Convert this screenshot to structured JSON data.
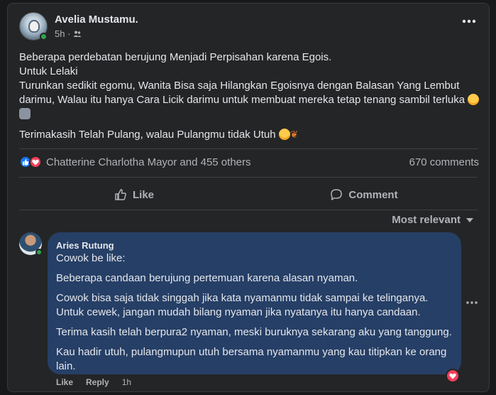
{
  "post": {
    "author": "Avelia Mustamu",
    "author_suffix": ".",
    "time": "5h ·",
    "audience_icon": "friends-icon",
    "lines": [
      "Beberapa perdebatan berujung Menjadi Perpisahan karena Egois.",
      "Untuk Lelaki",
      "Turunkan sedikit egomu, Wanita Bisa saja Hilangkan Egoisnya dengan Balasan Yang Lembut darimu, Walau itu hanya Cara Licik darimu untuk membuat mereka tetap tenang sambil terluka",
      "Terimakasih Telah Pulang, walau Pulangmu tidak Utuh"
    ]
  },
  "reactions": {
    "reactors": "Chatterine Charlotha Mayor and 455 others",
    "comments_count": "670 comments",
    "like_icon": "thumbs-up-icon",
    "love_icon": "heart-icon"
  },
  "actions": {
    "like_label": "Like",
    "comment_label": "Comment"
  },
  "sort": {
    "label": "Most relevant"
  },
  "comment": {
    "author": "Aries Rutung",
    "paragraphs": [
      "Cowok be like:",
      "Beberapa candaan berujung pertemuan karena alasan nyaman.",
      "Cowok bisa saja tidak singgah jika kata nyamanmu tidak sampai ke telinganya.",
      "Untuk cewek, jangan mudah bilang nyaman jika nyatanya itu hanya candaan.",
      "Terima kasih telah berpura2 nyaman, meski buruknya sekarang aku yang tanggung.",
      "Kau hadir utuh, pulangmupun utuh bersama nyamanmu yang kau titipkan ke orang lain."
    ],
    "like_label": "Like",
    "reply_label": "Reply",
    "time": "1h"
  },
  "colors": {
    "background": "#18191a",
    "card": "#242526",
    "comment_bubble": "#263f66",
    "like_blue": "#1877f2",
    "love_red": "#f33e58",
    "online_green": "#31a24c"
  }
}
